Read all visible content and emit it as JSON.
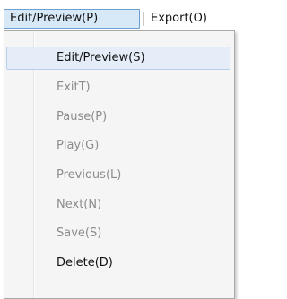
{
  "menubar": {
    "items": [
      {
        "label": "Edit/Preview(P)",
        "active": true
      },
      {
        "label": "Export(O)",
        "active": false
      }
    ]
  },
  "dropdown": {
    "items": [
      {
        "label": "Edit/Preview(S)",
        "enabled": true,
        "highlighted": true
      },
      {
        "label": "ExitT)",
        "enabled": false
      },
      {
        "label": "Pause(P)",
        "enabled": false
      },
      {
        "label": "Play(G)",
        "enabled": false
      },
      {
        "label": "Previous(L)",
        "enabled": false
      },
      {
        "label": "Next(N)",
        "enabled": false
      },
      {
        "label": "Save(S)",
        "enabled": false
      },
      {
        "label": "Delete(D)",
        "enabled": true
      }
    ]
  },
  "colors": {
    "highlight_bg": "#e5eef8",
    "active_menu_bg": "#d7e8f7",
    "disabled_text": "#8c8c8c",
    "enabled_text": "#111111"
  }
}
